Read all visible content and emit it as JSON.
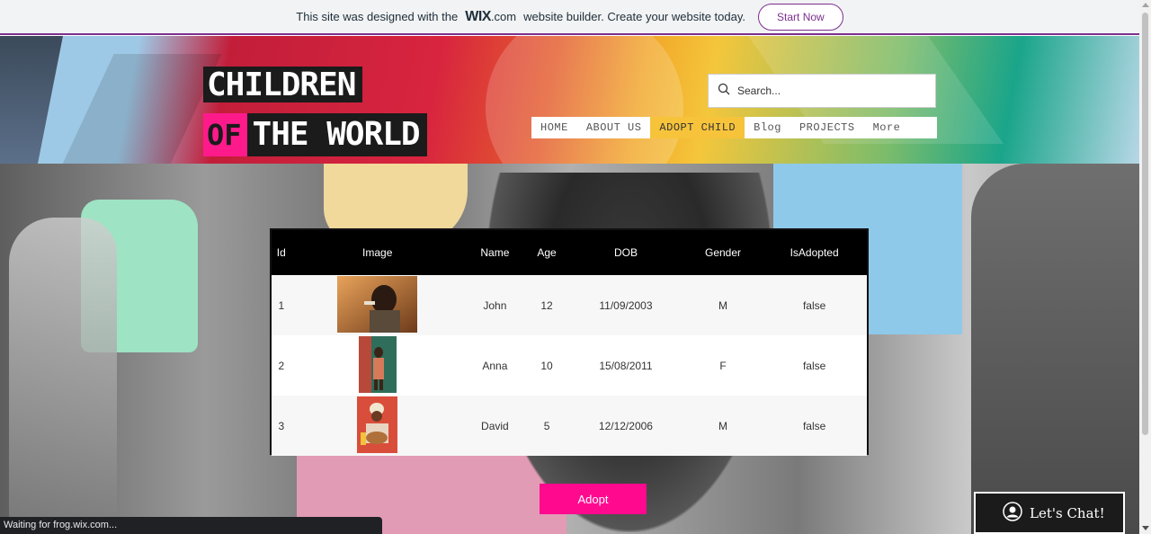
{
  "banner": {
    "text_before": "This site was designed with the",
    "wix_logo": "WIX",
    "wix_suffix": ".com",
    "text_after": "website builder. Create your website today.",
    "cta_label": "Start Now"
  },
  "logo": {
    "line1": "CHILDREN",
    "of": "OF",
    "world": "THE WORLD"
  },
  "search": {
    "placeholder": "Search..."
  },
  "nav": {
    "items": [
      {
        "label": "HOME"
      },
      {
        "label": "ABOUT US"
      },
      {
        "label": "ADOPT CHILD",
        "active": true
      },
      {
        "label": "Blog"
      },
      {
        "label": "PROJECTS"
      },
      {
        "label": "More"
      }
    ]
  },
  "table": {
    "columns": [
      "Id",
      "Image",
      "Name",
      "Age",
      "DOB",
      "Gender",
      "IsAdopted"
    ],
    "rows": [
      {
        "id": "1",
        "name": "John",
        "age": "12",
        "dob": "11/09/2003",
        "gender": "M",
        "is_adopted": "false",
        "image": "child-drinking-photo"
      },
      {
        "id": "2",
        "name": "Anna",
        "age": "10",
        "dob": "15/08/2011",
        "gender": "F",
        "is_adopted": "false",
        "image": "child-standing-photo"
      },
      {
        "id": "3",
        "name": "David",
        "age": "5",
        "dob": "12/12/2006",
        "gender": "M",
        "is_adopted": "false",
        "image": "child-drummer-photo"
      }
    ]
  },
  "adopt_button": {
    "label": "Adopt"
  },
  "chat": {
    "label": "Let's Chat!"
  },
  "status_bar": {
    "text": "Waiting for frog.wix.com..."
  },
  "colors": {
    "accent_pink": "#ff0a8f",
    "nav_active": "#f6c33b",
    "banner_border": "#7d2f8f"
  }
}
